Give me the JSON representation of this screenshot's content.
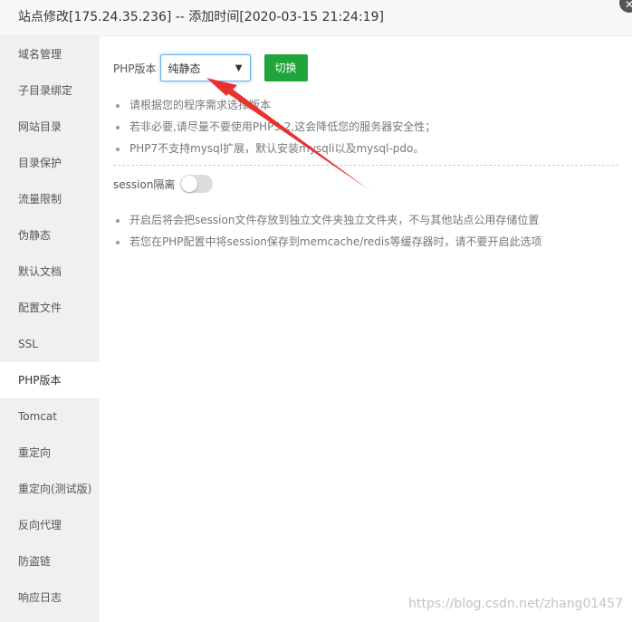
{
  "header": {
    "title": "站点修改[175.24.35.236] -- 添加时间[2020-03-15 21:24:19]",
    "close_icon": "close-icon"
  },
  "sidebar": {
    "items": [
      "域名管理",
      "子目录绑定",
      "网站目录",
      "目录保护",
      "流量限制",
      "伪静态",
      "默认文档",
      "配置文件",
      "SSL",
      "PHP版本",
      "Tomcat",
      "重定向",
      "重定向(测试版)",
      "反向代理",
      "防盗链",
      "响应日志"
    ],
    "active": "PHP版本"
  },
  "php": {
    "label": "PHP版本",
    "selected": "纯静态",
    "switch_label": "切换",
    "notes": [
      "请根据您的程序需求选择版本",
      "若非必要,请尽量不要使用PHP5.2,这会降低您的服务器安全性；",
      "PHP7不支持mysql扩展，默认安装mysqli以及mysql-pdo。"
    ]
  },
  "session": {
    "label": "session隔离",
    "enabled": false,
    "notes": [
      "开启后将会把session文件存放到独立文件夹独立文件夹，不与其他站点公用存储位置",
      "若您在PHP配置中将session保存到memcache/redis等缓存器时，请不要开启此选项"
    ]
  },
  "annotation_color": "#e8312f",
  "accent": "#20a53a",
  "watermark": "https://blog.csdn.net/zhang01457"
}
